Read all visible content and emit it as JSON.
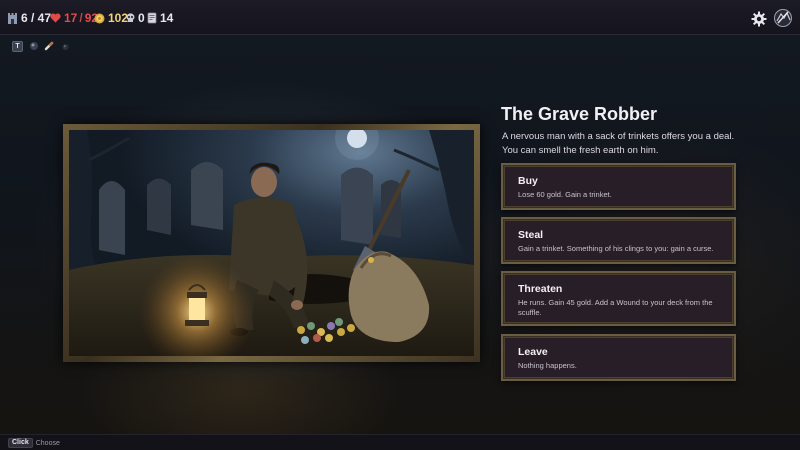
{
  "hud": {
    "floor": "6 / 47",
    "hp_current": "17",
    "hp_separator": "/",
    "hp_max": "92",
    "gold": "102",
    "kills": "0",
    "deck_count": "14"
  },
  "relics": [
    {
      "label": "T",
      "icon": "tonic-relic-icon"
    },
    {
      "label": "",
      "icon": "orb-relic-icon"
    },
    {
      "label": "",
      "icon": "scroll-relic-icon"
    },
    {
      "label": "",
      "icon": "stone-relic-icon"
    }
  ],
  "event": {
    "title": "The Grave Robber",
    "description_lines": [
      "A nervous man with a sack of trinkets offers you a deal.",
      "You can smell the fresh earth on him."
    ],
    "art": "grave-robber-illustration"
  },
  "options": [
    {
      "title": "Buy",
      "description": "Lose 60 gold. Gain a trinket."
    },
    {
      "title": "Steal",
      "description": "Gain a trinket. Something of his clings to you: gain a curse."
    },
    {
      "title": "Threaten",
      "description": "He runs. Gain 45 gold. Add a Wound to your deck from the scuffle."
    },
    {
      "title": "Leave",
      "description": "Nothing happens."
    }
  ],
  "hint": {
    "key": "Click",
    "action": "Choose"
  },
  "colors": {
    "hp": "#e24a4a",
    "gold": "#f0d27a",
    "option_bg": "#281e27",
    "option_border": "#6a5d45"
  }
}
